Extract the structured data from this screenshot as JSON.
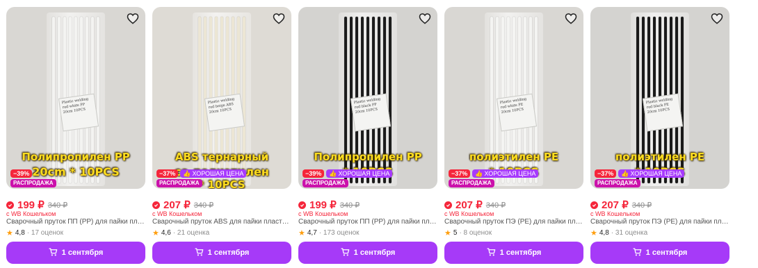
{
  "products": [
    {
      "overlay_line1": "Полипропилен PP",
      "overlay_line2": "20cm * 10PCS",
      "discount": "−39%",
      "good_price": "",
      "sale": "РАСПРОДАЖА",
      "price": "199 ₽",
      "old_price": "340 ₽",
      "wallet": "с WB Кошельком",
      "name": "Сварочный пруток ПП (PP) для пайки пластика",
      "rating": "4,8",
      "reviews": "· 17 оценок",
      "delivery": "1 сентября",
      "label_text": "Plastic welding rod white PP 20cm 10PCS",
      "rod_color": "#f3f3f1",
      "photo_tone": "light"
    },
    {
      "overlay_line1": "ABS тернарный",
      "overlay_line2": "со-полиэтилен",
      "overlay_line3": "* 10PCS",
      "discount": "−37%",
      "good_price": "ХОРОШАЯ ЦЕНА",
      "sale": "РАСПРОДАЖА",
      "price": "207 ₽",
      "old_price": "340 ₽",
      "wallet": "с WB Кошельком",
      "name": "Сварочный пруток ABS для пайки пластика",
      "rating": "4,6",
      "reviews": "· 21 оценка",
      "delivery": "1 сентября",
      "label_text": "Plastic welding rod beige ABS 20cm 10PCS",
      "rod_color": "#ece6d4",
      "photo_tone": "beige"
    },
    {
      "overlay_line1": "Полипропилен PP",
      "overlay_line2": "* 10PCS",
      "discount": "−39%",
      "good_price": "ХОРОШАЯ ЦЕНА",
      "sale": "РАСПРОДАЖА",
      "price": "199 ₽",
      "old_price": "340 ₽",
      "wallet": "с WB Кошельком",
      "name": "Сварочный пруток ПП (PP) для пайки пластика",
      "rating": "4,7",
      "reviews": "· 173 оценок",
      "delivery": "1 сентября",
      "label_text": "Plastic welding rod black PP 20cm 10PCS",
      "rod_color": "#1c1c1c",
      "photo_tone": "dark"
    },
    {
      "overlay_line1": "полиэтилен PE",
      "overlay_line2": "* 10PCS",
      "discount": "−37%",
      "good_price": "ХОРОШАЯ ЦЕНА",
      "sale": "РАСПРОДАЖА",
      "price": "207 ₽",
      "old_price": "340 ₽",
      "wallet": "с WB Кошельком",
      "name": "Сварочный пруток ПЭ (PE) для пайки пластика",
      "rating": "5",
      "reviews": "· 8 оценок",
      "delivery": "1 сентября",
      "label_text": "Plastic welding rod white PE 20cm 10PCS",
      "rod_color": "#f4f4f2",
      "photo_tone": "light"
    },
    {
      "overlay_line1": "полиэтилен PE",
      "overlay_line2": "* 10PCS",
      "discount": "−37%",
      "good_price": "ХОРОШАЯ ЦЕНА",
      "sale": "РАСПРОДАЖА",
      "price": "207 ₽",
      "old_price": "340 ₽",
      "wallet": "с WB Кошельком",
      "name": "Сварочный пруток ПЭ (PE) для пайки пластика",
      "rating": "4,8",
      "reviews": "· 31 оценка",
      "delivery": "1 сентября",
      "label_text": "Plastic welding rod black PE 20cm 10PCS",
      "rod_color": "#1a1a1a",
      "photo_tone": "dark"
    }
  ],
  "icons": {
    "favorite": "heart-outline-icon",
    "cart": "cart-icon",
    "star": "star-icon",
    "wallet": "wallet-check-icon",
    "good_price": "thumbs-up-icon"
  },
  "colors": {
    "accent": "#a63af8",
    "price": "#f5263b",
    "sale_badge": "#cb11ab"
  }
}
